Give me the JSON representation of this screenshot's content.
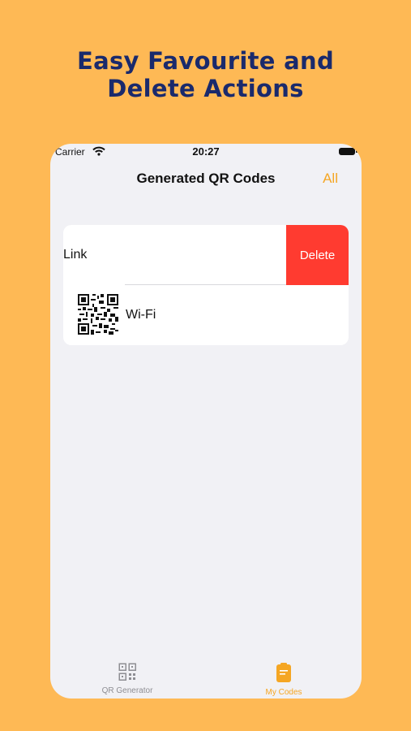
{
  "promo": {
    "line1": "Easy Favourite and",
    "line2": "Delete Actions"
  },
  "status_bar": {
    "carrier": "Carrier",
    "time": "20:27"
  },
  "nav": {
    "title": "Generated QR Codes",
    "right_button": "All"
  },
  "list": {
    "items": [
      {
        "label": "Link",
        "action_label": "Delete"
      },
      {
        "label": "Wi-Fi"
      }
    ]
  },
  "tabs": [
    {
      "label": "QR Generator",
      "icon": "qr-code-icon",
      "selected": false
    },
    {
      "label": "My Codes",
      "icon": "codes-card-icon",
      "selected": true
    }
  ],
  "colors": {
    "background": "#FEB955",
    "title": "#1A2A6C",
    "accent": "#F5A623",
    "delete": "#FF3B30",
    "inactive_tab": "#8E8E93"
  }
}
